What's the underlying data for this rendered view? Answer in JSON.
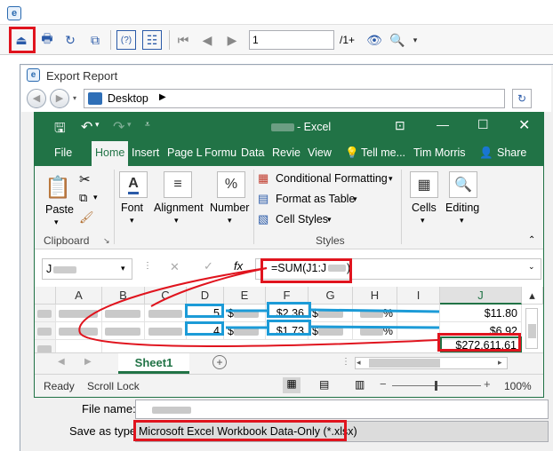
{
  "outer": {
    "page_input": "1",
    "page_total": "/1+",
    "help_label": "(?)"
  },
  "export_dialog": {
    "title": "Export Report",
    "address": "Desktop",
    "file_name_label": "File name:",
    "save_as_type_label": "Save as type:",
    "save_as_type_value": "Microsoft Excel Workbook Data-Only (*.xlsx)"
  },
  "excel": {
    "title_suffix": "- Excel",
    "tabs": [
      "File",
      "Home",
      "Insert",
      "Page L",
      "Formu",
      "Data",
      "Revie",
      "View"
    ],
    "tell_me": "Tell me...",
    "user_name": "Tim Morris",
    "share_label": "Share",
    "clipboard": {
      "paste": "Paste",
      "label": "Clipboard"
    },
    "font_label": "Font",
    "alignment_label": "Alignment",
    "number_label": "Number",
    "styles": {
      "conditional": "Conditional Formatting",
      "format_table": "Format as Table",
      "cell_styles": "Cell Styles",
      "label": "Styles"
    },
    "cells_label": "Cells",
    "editing_label": "Editing",
    "name_box": "J",
    "fx": "fx",
    "formula": "=SUM(J1:J",
    "formula_end": ")",
    "columns": [
      "A",
      "B",
      "C",
      "D",
      "E",
      "F",
      "G",
      "H",
      "I",
      "J"
    ],
    "rows": [
      {
        "d": "5",
        "e": "$",
        "f": "$2.36",
        "g": "$",
        "h": "%",
        "j": "$11.80"
      },
      {
        "d": "4",
        "e": "$",
        "f": "$1.73",
        "g": "$",
        "h": "%",
        "j": "$6.92"
      },
      {
        "j": "$272,611.61"
      }
    ],
    "sheet_tab": "Sheet1",
    "status": {
      "ready": "Ready",
      "scroll_lock": "Scroll Lock",
      "zoom": "100%"
    }
  },
  "colors": {
    "excel_green": "#217346",
    "highlight_red": "#e0141e",
    "highlight_blue": "#1c9bd7"
  }
}
